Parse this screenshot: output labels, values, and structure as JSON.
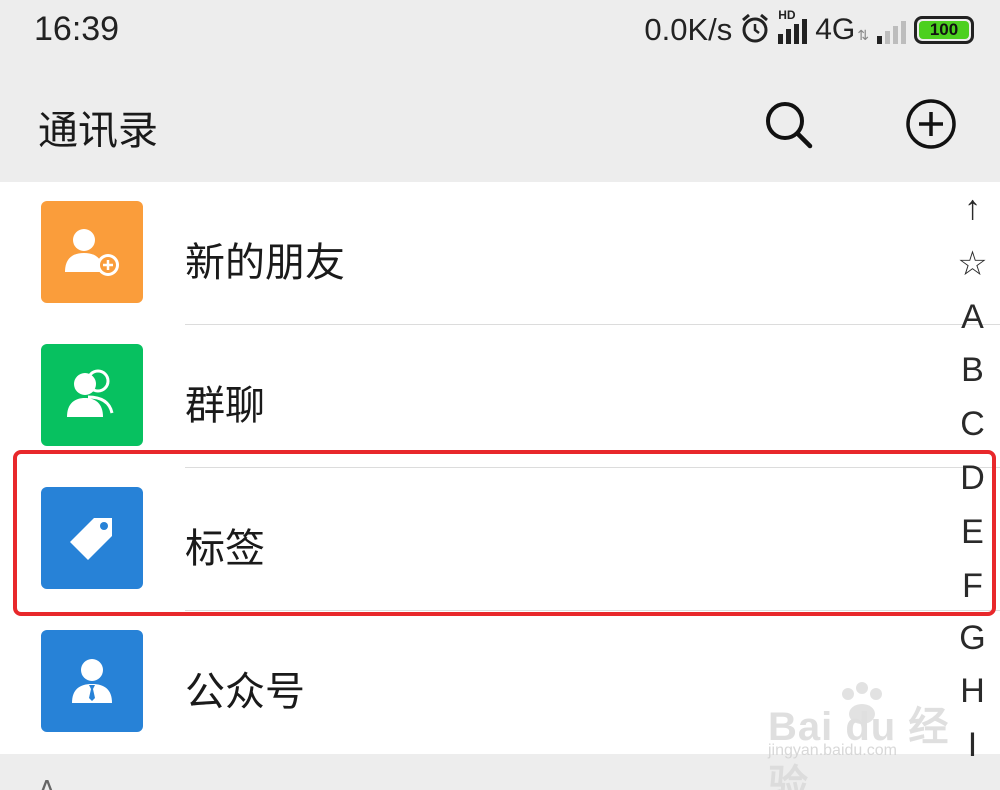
{
  "status_bar": {
    "time": "16:39",
    "net_speed": "0.0K/s",
    "alarm_icon": "alarm-clock-icon",
    "hd_label": "HD",
    "net_type": "4G",
    "battery_level": "100",
    "battery_color": "#4cd01f"
  },
  "nav": {
    "title": "通讯录",
    "search_icon": "search-icon",
    "add_icon": "add-circle-icon"
  },
  "list": {
    "items": [
      {
        "label": "新的朋友",
        "icon": "add-friend-icon",
        "color": "#fa9d3b"
      },
      {
        "label": "群聊",
        "icon": "group-chat-icon",
        "color": "#07c160"
      },
      {
        "label": "标签",
        "icon": "tag-icon",
        "color": "#2782d7"
      },
      {
        "label": "公众号",
        "icon": "official-account-icon",
        "color": "#2782d7"
      }
    ]
  },
  "section_header": {
    "letter": "A"
  },
  "alpha_index": [
    "↑",
    "☆",
    "A",
    "B",
    "C",
    "D",
    "E",
    "F",
    "G",
    "H",
    "I"
  ],
  "annotation": {
    "highlight_color": "#e8282b"
  },
  "watermark": {
    "main": "Bai du 经验",
    "sub": "jingyan.baidu.com"
  }
}
